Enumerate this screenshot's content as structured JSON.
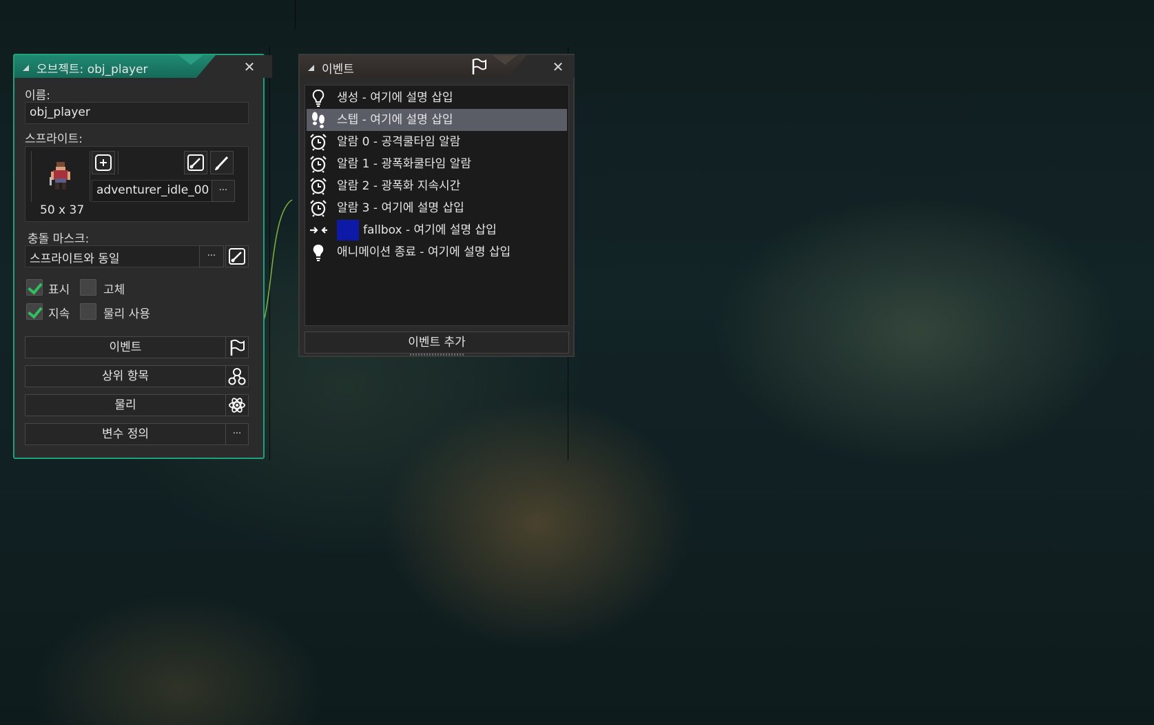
{
  "object_panel": {
    "title": "오브젝트: obj_player",
    "name_label": "이름:",
    "name_value": "obj_player",
    "sprite_label": "스프라이트:",
    "sprite_name": "adventurer_idle_00",
    "sprite_size": "50 x 37",
    "more_label": "···",
    "mask_label": "충돌 마스크:",
    "mask_value": "스프라이트와 동일",
    "visible_label": "표시",
    "visible_checked": true,
    "solid_label": "고체",
    "solid_checked": false,
    "persistent_label": "지속",
    "persistent_checked": true,
    "physics_label": "물리 사용",
    "physics_checked": false,
    "events_button": "이벤트",
    "parent_button": "상위 항목",
    "physics_button": "물리",
    "variables_button": "변수 정의",
    "accent_color": "#1fa07f"
  },
  "events_panel": {
    "title": "이벤트",
    "add_event_button": "이벤트 추가",
    "events": [
      {
        "icon": "lightbulb-outline-icon",
        "text": "생성 - 여기에 설명 삽입"
      },
      {
        "icon": "footsteps-icon",
        "text": "스텝 - 여기에 설명 삽입",
        "selected": true
      },
      {
        "icon": "alarm-clock-icon",
        "text": "알람 0 - 공격쿨타임 알람"
      },
      {
        "icon": "alarm-clock-icon",
        "text": "알람 1 - 광폭화쿨타임 알람"
      },
      {
        "icon": "alarm-clock-icon",
        "text": "알람 2 - 광폭화 지속시간"
      },
      {
        "icon": "alarm-clock-icon",
        "text": "알람 3 - 여기에 설명 삽입"
      },
      {
        "icon": "collision-arrows-icon",
        "text": "fallbox - 여기에 설명 삽입",
        "swatch": "#0d1aa8"
      },
      {
        "icon": "lightbulb-filled-icon",
        "text": "애니메이션 종료 - 여기에 설명 삽입"
      }
    ],
    "selected_color": "#5a5d66"
  }
}
